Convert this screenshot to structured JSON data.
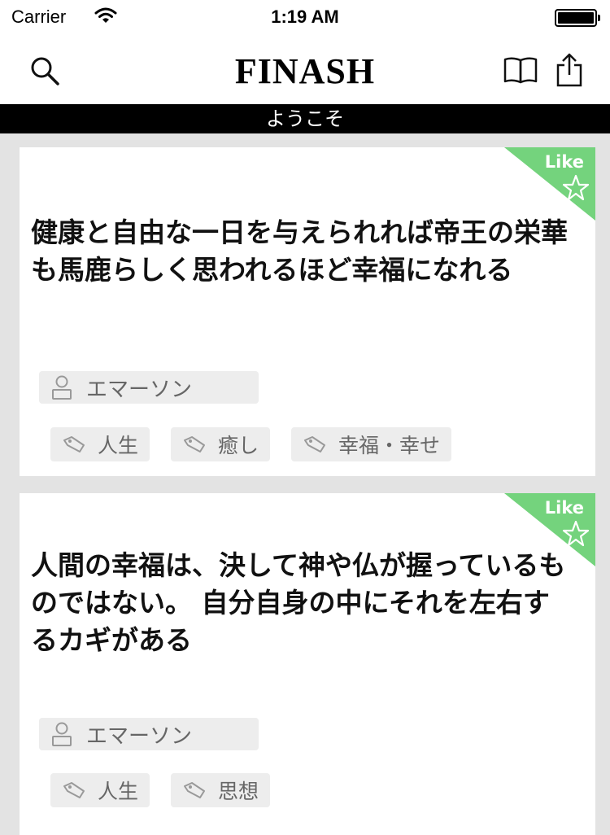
{
  "status_bar": {
    "carrier": "Carrier",
    "time": "1:19 AM",
    "wifi_icon": "wifi-icon",
    "battery_icon": "battery-icon"
  },
  "nav": {
    "title": "FINASH",
    "left_icon": "search-icon",
    "right_icons": [
      "book-icon",
      "share-icon"
    ]
  },
  "subtitle": "ようこそ",
  "colors": {
    "like_ribbon": "#74d37d",
    "subtitle_bar": "#000000",
    "background": "#e3e3e3"
  },
  "cards": [
    {
      "like_label": "Like",
      "quote": "健康と自由な一日を与えられれば帝王の栄華も馬鹿らしく思われるほど幸福になれる",
      "author": "エマーソン",
      "tags": [
        "人生",
        "癒し",
        "幸福・幸せ"
      ]
    },
    {
      "like_label": "Like",
      "quote": "人間の幸福は、決して神や仏が握っているものではない。 自分自身の中にそれを左右するカギがある",
      "author": "エマーソン",
      "tags": [
        "人生",
        "思想"
      ]
    }
  ]
}
